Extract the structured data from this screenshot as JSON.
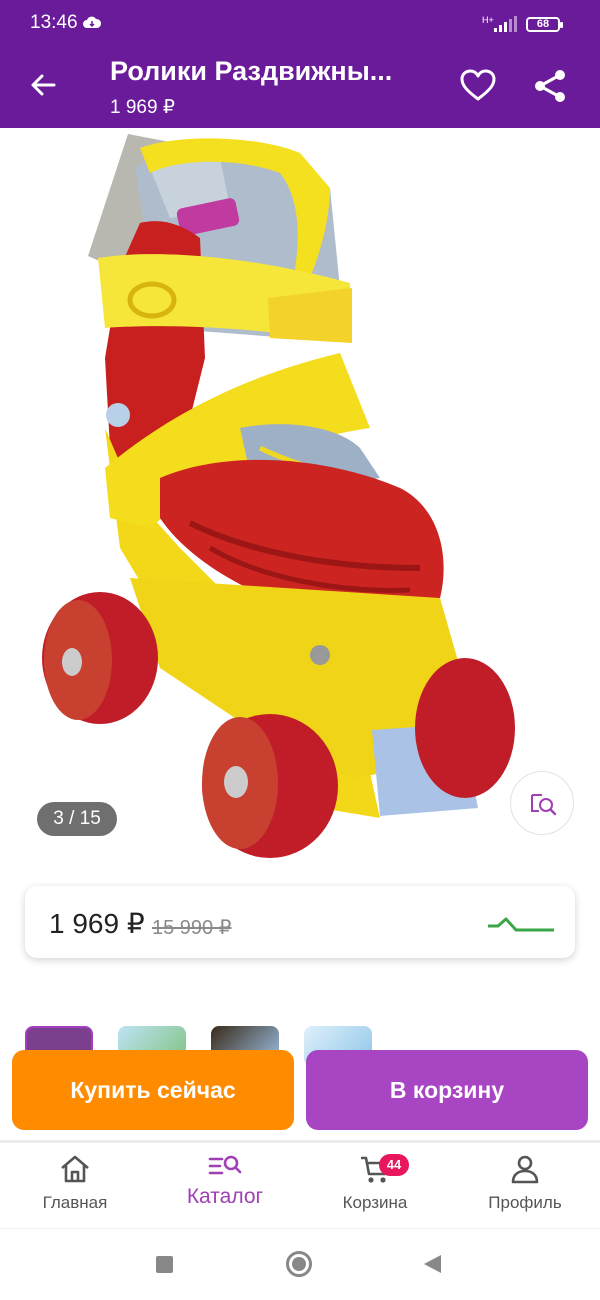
{
  "status_bar": {
    "time": "13:46",
    "network": "H+",
    "battery": "68"
  },
  "header": {
    "title": "Ролики Раздвижны...",
    "price": "1 969 ₽"
  },
  "gallery": {
    "counter": "3 / 15",
    "current": 3,
    "total": 15
  },
  "price_card": {
    "price": "1 969 ₽",
    "old_price": "15 990 ₽",
    "trend_color": "#3aa64a"
  },
  "actions": {
    "buy_now": "Купить сейчас",
    "add_to_cart": "В корзину"
  },
  "bottom_nav": {
    "items": [
      {
        "label": "Главная",
        "icon": "home-icon"
      },
      {
        "label": "Каталог",
        "icon": "catalog-search-icon",
        "active": true
      },
      {
        "label": "Корзина",
        "icon": "cart-icon",
        "badge": "44"
      },
      {
        "label": "Профиль",
        "icon": "profile-icon"
      }
    ]
  },
  "colors": {
    "brand": "#6a1b9a",
    "buy_button": "#ff8c00",
    "cart_button": "#a845c2",
    "badge": "#e8175d",
    "active_nav": "#a040b5"
  }
}
